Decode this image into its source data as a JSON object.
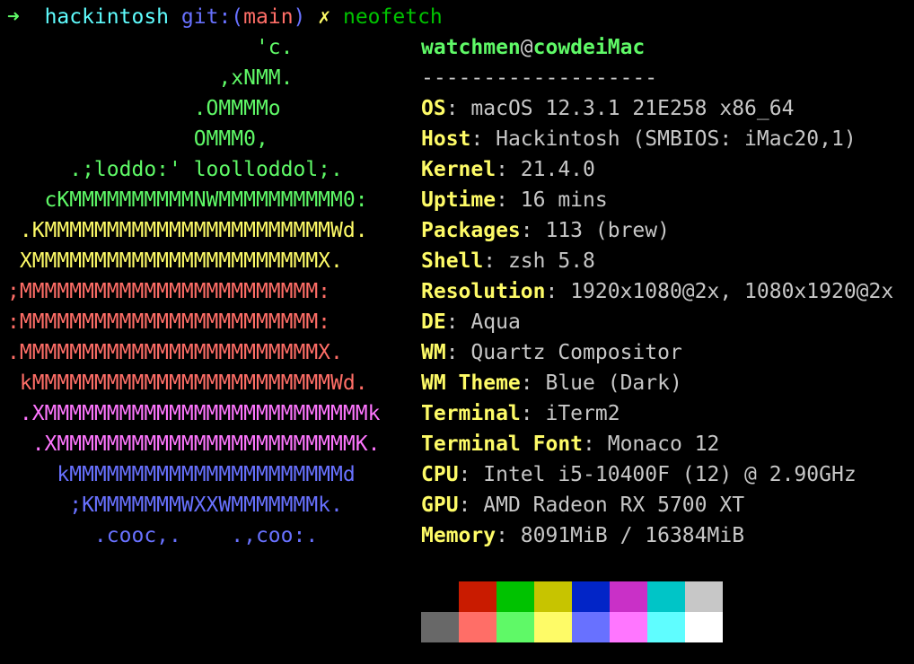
{
  "prompt": {
    "arrow": "➜",
    "dir": "hackintosh",
    "git_prefix": "git:(",
    "branch": "main",
    "git_suffix": ")",
    "dirty_mark": "✗",
    "command": "neofetch"
  },
  "logo": [
    {
      "text": "                    'c.",
      "color": "#5ff967"
    },
    {
      "text": "                 ,xNMM.",
      "color": "#5ff967"
    },
    {
      "text": "               .OMMMMo",
      "color": "#5ff967"
    },
    {
      "text": "               OMMM0,",
      "color": "#5ff967"
    },
    {
      "text": "     .;loddo:' loolloddol;.",
      "color": "#5ff967"
    },
    {
      "text": "   cKMMMMMMMMMMNWMMMMMMMMMM0:",
      "color": "#5ff967"
    },
    {
      "text": " .KMMMMMMMMMMMMMMMMMMMMMMMWd.",
      "color": "#fefb67"
    },
    {
      "text": " XMMMMMMMMMMMMMMMMMMMMMMMX.",
      "color": "#fefb67"
    },
    {
      "text": ";MMMMMMMMMMMMMMMMMMMMMMMM:",
      "color": "#ff6e67"
    },
    {
      "text": ":MMMMMMMMMMMMMMMMMMMMMMMM:",
      "color": "#ff6e67"
    },
    {
      "text": ".MMMMMMMMMMMMMMMMMMMMMMMMX.",
      "color": "#ff6e67"
    },
    {
      "text": " kMMMMMMMMMMMMMMMMMMMMMMMMWd.",
      "color": "#ff6e67"
    },
    {
      "text": " .XMMMMMMMMMMMMMMMMMMMMMMMMMMk",
      "color": "#ff76ff"
    },
    {
      "text": "  .XMMMMMMMMMMMMMMMMMMMMMMMMK.",
      "color": "#ff76ff"
    },
    {
      "text": "    kMMMMMMMMMMMMMMMMMMMMMMd",
      "color": "#6871ff"
    },
    {
      "text": "     ;KMMMMMMMWXXWMMMMMMMk.",
      "color": "#6871ff"
    },
    {
      "text": "       .cooc,.    .,coo:.",
      "color": "#6871ff"
    }
  ],
  "info": {
    "user": "watchmen",
    "at": "@",
    "host": "cowdeiMac",
    "separator": "-------------------",
    "rows": [
      {
        "key": "OS",
        "value": "macOS 12.3.1 21E258 x86_64"
      },
      {
        "key": "Host",
        "value": "Hackintosh (SMBIOS: iMac20,1)"
      },
      {
        "key": "Kernel",
        "value": "21.4.0"
      },
      {
        "key": "Uptime",
        "value": "16 mins"
      },
      {
        "key": "Packages",
        "value": "113 (brew)"
      },
      {
        "key": "Shell",
        "value": "zsh 5.8"
      },
      {
        "key": "Resolution",
        "value": "1920x1080@2x, 1080x1920@2x"
      },
      {
        "key": "DE",
        "value": "Aqua"
      },
      {
        "key": "WM",
        "value": "Quartz Compositor"
      },
      {
        "key": "WM Theme",
        "value": "Blue (Dark)"
      },
      {
        "key": "Terminal",
        "value": "iTerm2"
      },
      {
        "key": "Terminal Font",
        "value": "Monaco 12"
      },
      {
        "key": "CPU",
        "value": "Intel i5-10400F (12) @ 2.90GHz"
      },
      {
        "key": "GPU",
        "value": "AMD Radeon RX 5700 XT"
      },
      {
        "key": "Memory",
        "value": "8091MiB / 16384MiB"
      }
    ]
  },
  "palette": {
    "normal": [
      "#000000",
      "#c91b00",
      "#00c200",
      "#c7c400",
      "#0225c7",
      "#c930c7",
      "#00c5c7",
      "#c7c7c7"
    ],
    "bright": [
      "#686868",
      "#ff6e67",
      "#5ff967",
      "#fefb67",
      "#6871ff",
      "#ff76ff",
      "#5ffdff",
      "#ffffff"
    ]
  }
}
